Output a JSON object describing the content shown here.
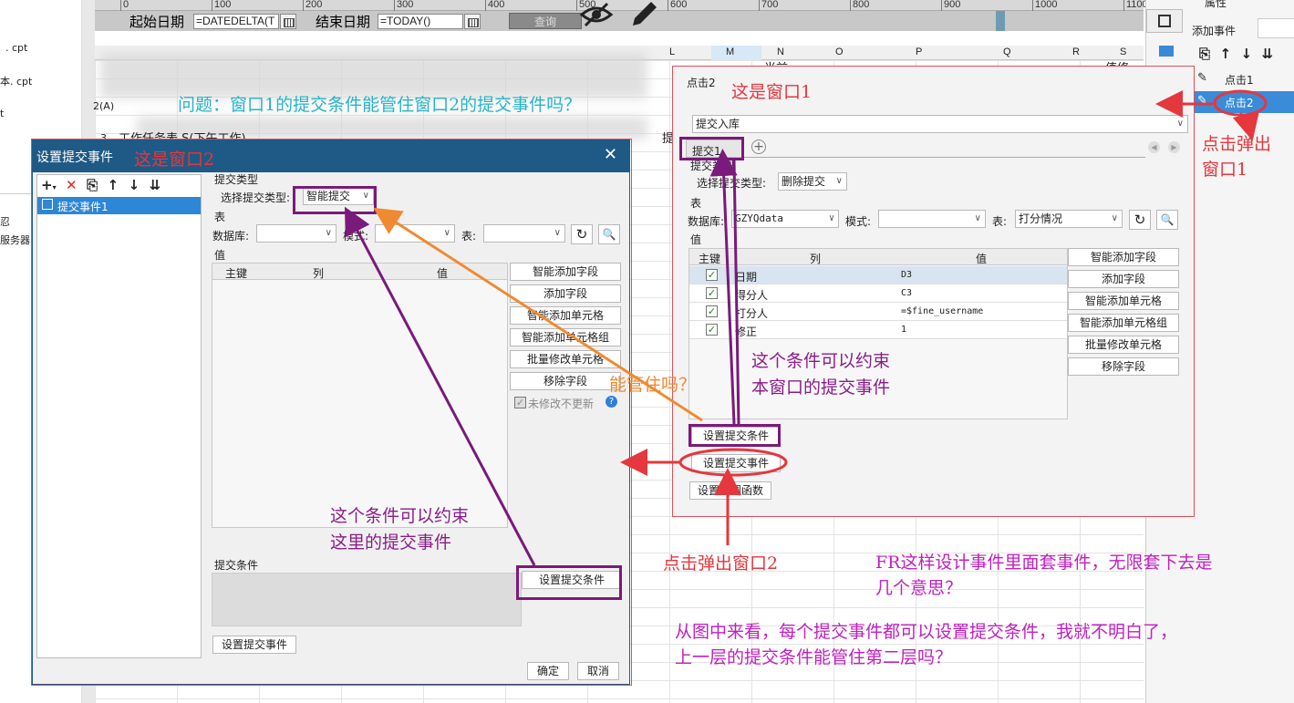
{
  "ruler": {
    "ticks": [
      "0",
      "100",
      "200",
      "300",
      "400",
      "500",
      "600",
      "700",
      "800",
      "900",
      "1000",
      "1100"
    ]
  },
  "param_bar": {
    "start_label": "起始日期",
    "start_value": "=DATEDELTA(T",
    "end_label": "结束日期",
    "end_value": "=TODAY()",
    "query_label": "查询"
  },
  "columns": [
    "L",
    "M",
    "N",
    "O",
    "P",
    "Q",
    "R",
    "S"
  ],
  "left_panel": {
    "items": [
      ". cpt",
      "本. cpt",
      "t",
      "忍",
      "服务器"
    ]
  },
  "grid_text": {
    "row2": "2(A)",
    "row3_num": "3",
    "row3": "工作任务表 S(下午工作)",
    "cell_m": "当前",
    "cell_s": "值修",
    "cell_l": "提"
  },
  "right_props": {
    "header": "属性",
    "add_event_label": "添加事件",
    "events": [
      "点击1",
      "点击2"
    ]
  },
  "window2": {
    "title": "设置提交事件",
    "toolbar_icons": [
      "add-icon",
      "delete-icon",
      "copy-icon",
      "up-icon",
      "down-icon",
      "move-bottom-icon"
    ],
    "event_list": [
      "提交事件1"
    ],
    "submit_type_section": "提交类型",
    "submit_type_label": "选择提交类型:",
    "submit_type_value": "智能提交",
    "table_section": "表",
    "database_label": "数据库:",
    "schema_label": "模式:",
    "table_label": "表:",
    "value_section": "值",
    "columns": [
      "主键",
      "列",
      "值"
    ],
    "buttons": [
      "智能添加字段",
      "添加字段",
      "智能添加单元格",
      "智能添加单元格组",
      "批量修改单元格",
      "移除字段"
    ],
    "unchanged_label": "未修改不更新",
    "help_icon": "?",
    "condition_section": "提交条件",
    "set_condition_button": "设置提交条件",
    "set_event_button": "设置提交事件",
    "ok_button": "确定",
    "cancel_button": "取消"
  },
  "window1": {
    "title": "点击2",
    "action_value": "提交入库",
    "tab": "提交1",
    "submit_type_section": "提交类型",
    "submit_type_label": "选择提交类型:",
    "submit_type_value": "删除提交",
    "table_section": "表",
    "database_label": "数据库:",
    "database_value": "GZYQdata",
    "schema_label": "模式:",
    "table_label": "表:",
    "table_value": "打分情况",
    "value_section": "值",
    "columns": [
      "主键",
      "列",
      "值"
    ],
    "rows": [
      {
        "col": "日期",
        "val": "D3"
      },
      {
        "col": "得分人",
        "val": "C3"
      },
      {
        "col": "打分人",
        "val": "=$fine_username"
      },
      {
        "col": "修正",
        "val": "1"
      }
    ],
    "buttons": [
      "智能添加字段",
      "添加字段",
      "智能添加单元格",
      "智能添加单元格组",
      "批量修改单元格",
      "移除字段"
    ],
    "set_condition_button": "设置提交条件",
    "set_event_button": "设置提交事件",
    "set_callback_button": "设置回调函数"
  },
  "annotations": {
    "question": "问题：窗口1的提交条件能管住窗口2的提交事件吗？",
    "this_is_window2": "这是窗口2",
    "this_is_window1": "这是窗口1",
    "click_popup_window1_line1": "点击弹出",
    "click_popup_window1_line2": "窗口1",
    "click_popup_window2": "点击弹出窗口2",
    "can_control": "能管住吗？",
    "constraint_this_window_line1": "这个条件可以约束",
    "constraint_this_window_line2": "本窗口的提交事件",
    "constraint_here_line1": "这个条件可以约束",
    "constraint_here_line2": "这里的提交事件",
    "fr_design_line1": "FR这样设计事件里面套事件，无限套下去是",
    "fr_design_line2": "几个意思？",
    "from_image_line1": "从图中来看，每个提交事件都可以设置提交条件，我就不明白了，",
    "from_image_line2": "上一层的提交条件能管住第二层吗？"
  }
}
